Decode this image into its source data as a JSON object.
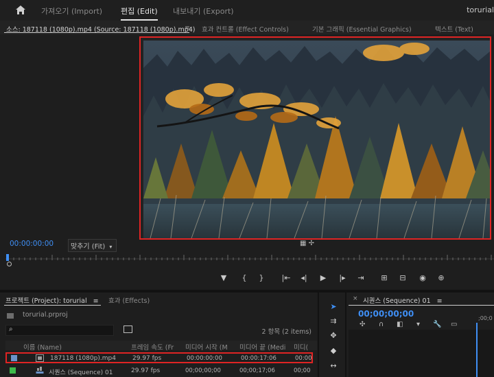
{
  "menu": {
    "home_icon": "home-icon",
    "items": [
      {
        "label": "가져오기 (Import)",
        "active": false
      },
      {
        "label": "편집 (Edit)",
        "active": true
      },
      {
        "label": "내보내기 (Export)",
        "active": false
      }
    ],
    "project_name": "torurial"
  },
  "source_monitor": {
    "tabs": [
      {
        "label": "소스: 187118 (1080p).mp4 (Source: 187118 (1080p).mp4)",
        "active": true
      },
      {
        "label": "효과 컨트롤 (Effect Controls)",
        "active": false
      },
      {
        "label": "기본 그래픽 (Essential Graphics)",
        "active": false
      },
      {
        "label": "텍스트 (Text)",
        "active": false
      }
    ],
    "tab_menu_glyph": "≡",
    "timecode": "00:00:00:00",
    "fit_label": "맞추기 (Fit)",
    "fit_arrow": "▾",
    "icons_text": "▦  ✢"
  },
  "transport": [
    {
      "name": "marker-icon",
      "glyph": "▼"
    },
    {
      "name": "mark-in-icon",
      "glyph": "{"
    },
    {
      "name": "mark-out-icon",
      "glyph": "}"
    },
    {
      "name": "go-to-in-icon",
      "glyph": "|⇤"
    },
    {
      "name": "step-back-icon",
      "glyph": "◂|"
    },
    {
      "name": "play-icon",
      "glyph": "▶"
    },
    {
      "name": "step-forward-icon",
      "glyph": "|▸"
    },
    {
      "name": "go-to-out-icon",
      "glyph": "⇥"
    },
    {
      "name": "insert-icon",
      "glyph": "⊞"
    },
    {
      "name": "overwrite-icon",
      "glyph": "⊟"
    },
    {
      "name": "camera-icon",
      "glyph": "◉"
    },
    {
      "name": "button-editor-icon",
      "glyph": "⊕"
    }
  ],
  "project_panel": {
    "tab_label": "프로젝트 (Project): torurial",
    "tab_menu_glyph": "≡",
    "effects_tab": "효과 (Effects)",
    "prproj": "torurial.prproj",
    "search_icon": "⌕",
    "item_count": "2 항목 (2 items)",
    "columns": [
      "이름 (Name)",
      "프레임 속도 (Fr",
      "미디어 시작 (M",
      "미디어 끝 (Medi",
      "미디("
    ],
    "rows": [
      {
        "color": "#6b93c9",
        "icon": "video-file-icon",
        "name": "187118 (1080p).mp4",
        "fps": "29.97 fps",
        "start": "00:00:00:00",
        "end": "00:00:17:06",
        "dur": "00:00"
      },
      {
        "color": "#3cba4a",
        "icon": "sequence-icon",
        "name": "시퀀스 (Sequence) 01",
        "fps": "29.97 fps",
        "start": "00;00;00;00",
        "end": "00;00;17;06",
        "dur": "00;00"
      }
    ]
  },
  "tools": [
    {
      "name": "selection-tool-icon",
      "glyph": "➤"
    },
    {
      "name": "track-select-tool-icon",
      "glyph": "⇉"
    },
    {
      "name": "ripple-edit-tool-icon",
      "glyph": "✥"
    },
    {
      "name": "razor-tool-icon",
      "glyph": "◆"
    },
    {
      "name": "slip-tool-icon",
      "glyph": "↔"
    }
  ],
  "sequence_panel": {
    "close_glyph": "×",
    "tab_label": "시퀀스 (Sequence) 01",
    "tab_menu_glyph": "≡",
    "timecode": "00;00;00;00",
    "ruler_tc": ";00;0",
    "icons": [
      "✣",
      "∩",
      "◧",
      "▾",
      "🔧",
      "▭"
    ]
  },
  "colors": {
    "accent": "#3f8ff5",
    "highlight": "#e02424"
  }
}
